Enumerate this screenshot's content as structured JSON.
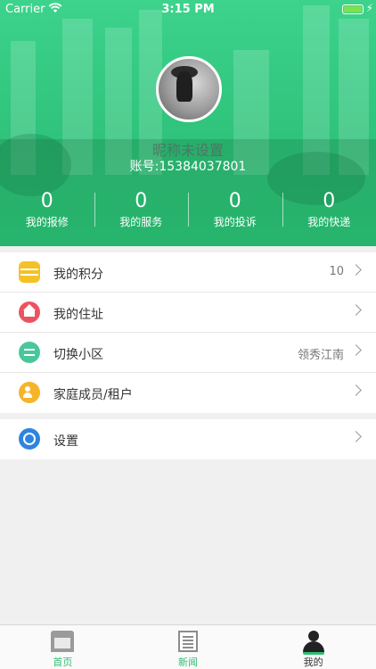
{
  "status_bar": {
    "carrier": "Carrier",
    "time": "3:15 PM"
  },
  "profile": {
    "nickname": "昵称未设置",
    "account": "账号:15384037801"
  },
  "stats": [
    {
      "value": "0",
      "label": "我的报修"
    },
    {
      "value": "0",
      "label": "我的服务"
    },
    {
      "value": "0",
      "label": "我的投诉"
    },
    {
      "value": "0",
      "label": "我的快递"
    }
  ],
  "menu": [
    {
      "label": "我的积分",
      "value": "10",
      "icon": "coins-icon"
    },
    {
      "label": "我的住址",
      "value": "",
      "icon": "home-icon"
    },
    {
      "label": "切换小区",
      "value": "领秀江南",
      "icon": "switch-icon"
    },
    {
      "label": "家庭成员/租户",
      "value": "",
      "icon": "family-icon"
    }
  ],
  "settings": {
    "label": "设置",
    "icon": "gear-icon"
  },
  "tabs": [
    {
      "label": "首页",
      "icon": "house-icon"
    },
    {
      "label": "新闻",
      "icon": "news-icon"
    },
    {
      "label": "我的",
      "icon": "person-icon"
    }
  ],
  "colors": {
    "header_green": "#2fc37b",
    "tab_active_green": "#2fbf73",
    "tab_inactive": "#333333"
  }
}
